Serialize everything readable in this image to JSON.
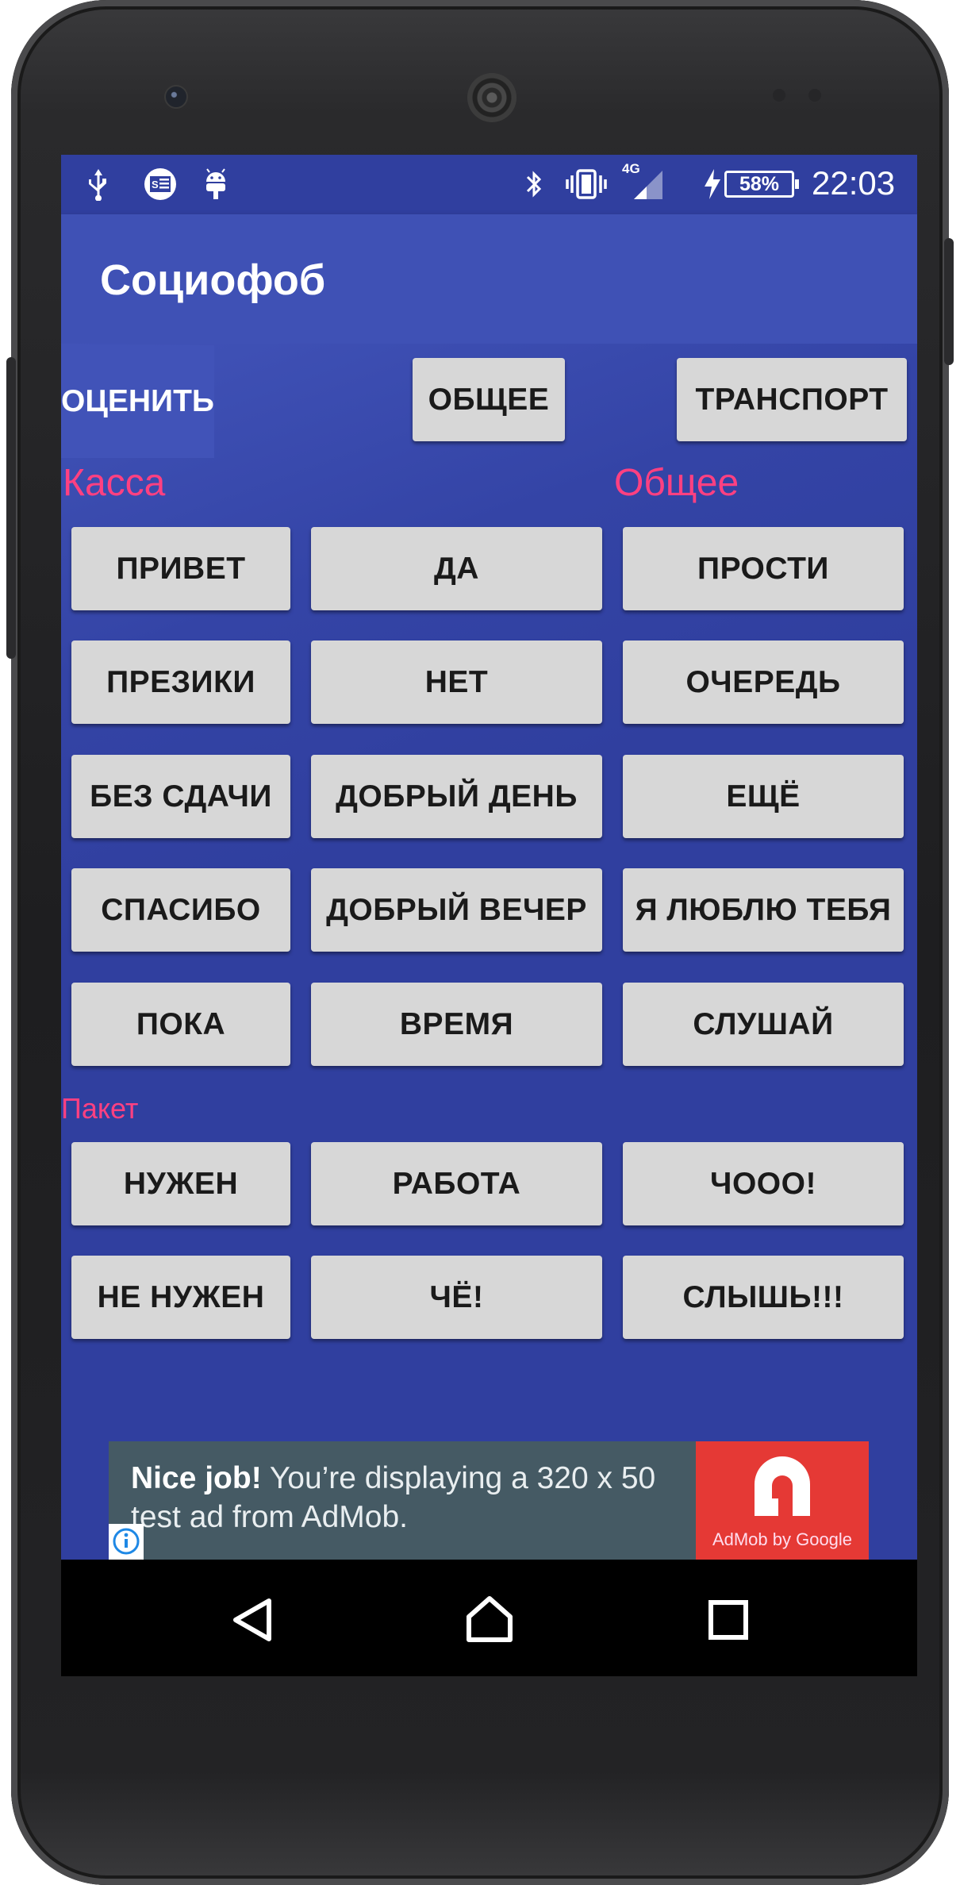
{
  "status_bar": {
    "network_type": "4G",
    "battery_percent": "58%",
    "time": "22:03",
    "icons_left": [
      "usb-icon",
      "sim-card-icon",
      "android-debug-icon"
    ],
    "icons_right": [
      "bluetooth-icon",
      "vibrate-icon",
      "signal-icon",
      "charging-icon",
      "battery-icon"
    ]
  },
  "app_bar": {
    "title": "Социофоб"
  },
  "top_buttons": {
    "rate": "ОЦЕНИТЬ",
    "general": "ОБЩЕЕ",
    "transport": "ТРАНСПОРТ"
  },
  "sections": {
    "kassa": "Касса",
    "obshee": "Общее",
    "paket": "Пакет"
  },
  "grid_buttons": [
    [
      "ПРИВЕТ",
      "ДА",
      "ПРОСТИ"
    ],
    [
      "ПРЕЗИКИ",
      "НЕТ",
      "ОЧЕРЕДЬ"
    ],
    [
      "БЕЗ СДАЧИ",
      "ДОБРЫЙ ДЕНЬ",
      "ЕЩЁ"
    ],
    [
      "СПАСИБО",
      "ДОБРЫЙ ВЕЧЕР",
      "Я ЛЮБЛЮ ТЕБЯ"
    ],
    [
      "ПОКА",
      "ВРЕМЯ",
      "СЛУШАЙ"
    ]
  ],
  "paket_buttons": [
    [
      "НУЖЕН",
      "РАБОТА",
      "ЧООО!"
    ],
    [
      "НЕ НУЖЕН",
      "ЧЁ!",
      "СЛЫШЬ!!!"
    ]
  ],
  "ad": {
    "headline": "Nice job!",
    "body": " You’re displaying a 320 x 50 test ad from AdMob.",
    "brand": "AdMob by Google"
  },
  "colors": {
    "primary": "#3f51b5",
    "primary_dark": "#303f9f",
    "accent": "#ff4081",
    "button": "#d7d7d7"
  }
}
